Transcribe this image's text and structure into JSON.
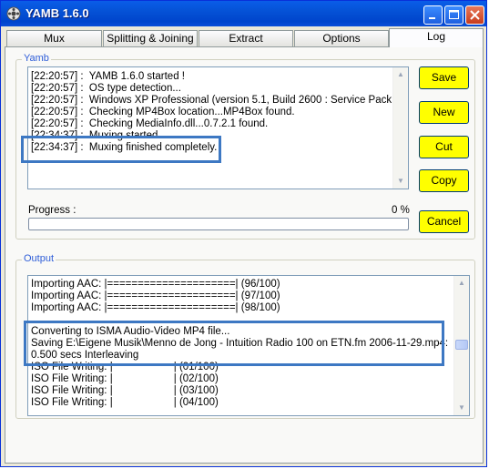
{
  "window": {
    "title": "YAMB 1.6.0",
    "controls": [
      "minimize-icon",
      "maximize-icon",
      "close-icon"
    ]
  },
  "tabs": [
    {
      "label": "Mux",
      "active": false
    },
    {
      "label": "Splitting & Joining",
      "active": false
    },
    {
      "label": "Extract",
      "active": false
    },
    {
      "label": "Options",
      "active": false
    },
    {
      "label": "Log",
      "active": true
    }
  ],
  "yamb_group": {
    "title": "Yamb",
    "log_lines": [
      "[22:20:57] :  YAMB 1.6.0 started !",
      "[22:20:57] :  OS type detection...",
      "[22:20:57] :  Windows XP Professional (version 5.1, Build 2600 : Service Pack 2)",
      "[22:20:57] :  Checking MP4Box location...MP4Box found.",
      "[22:20:57] :  Checking MediaInfo.dll...0.7.2.1 found.",
      "[22:34:37] :  Muxing started",
      "[22:34:37] :  Muxing finished completely."
    ],
    "progress_label": "Progress :",
    "progress_value": "0 %",
    "progress_fraction": 0.0,
    "buttons": {
      "save": "Save",
      "new": "New",
      "cut": "Cut",
      "copy": "Copy",
      "cancel": "Cancel"
    }
  },
  "output_group": {
    "title": "Output",
    "lines": [
      "Importing AAC: |=====================| (96/100)",
      "Importing AAC: |=====================| (97/100)",
      "Importing AAC: |=====================| (98/100)",
      "",
      "Converting to ISMA Audio-Video MP4 file...",
      "Saving E:\\Eigene Musik\\Menno de Jong - Intuition Radio 100 on ETN.fm 2006-11-29.mp4:",
      "0.500 secs Interleaving",
      "ISO File Writing: |                     | (01/100)",
      "ISO File Writing: |                     | (02/100)",
      "ISO File Writing: |                     | (03/100)",
      "ISO File Writing: |                     | (04/100)"
    ]
  },
  "colors": {
    "title_bar": "#0552d6",
    "button_fill": "#ffff00",
    "highlight_border": "#3d78c3",
    "group_title": "#2f5ed8"
  }
}
